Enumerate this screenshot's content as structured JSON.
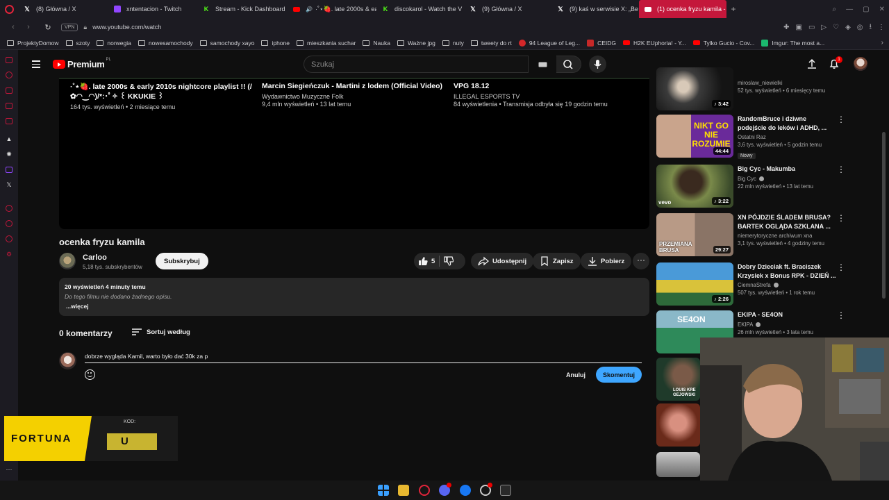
{
  "browser": {
    "tabs": [
      {
        "label": "(8) Główna / X",
        "icon": "x-logo-icon"
      },
      {
        "label": "xntentacion - Twitch",
        "icon": "twitch-icon"
      },
      {
        "label": "Stream - Kick Dashboard",
        "icon": "kick-icon"
      },
      {
        "label": "·˚⋆🍓. late 2000s & ear",
        "icon": "youtube-icon"
      },
      {
        "label": "discokarol - Watch the V",
        "icon": "kick-icon"
      },
      {
        "label": "(9) Główna / X",
        "icon": "x-logo-icon"
      },
      {
        "label": "(9) kaś w serwisie X: „Be",
        "icon": "x-logo-icon"
      },
      {
        "label": "(1) ocenka fryzu kamila -",
        "icon": "youtube-icon"
      }
    ],
    "vpn_label": "VPN",
    "url": "www.youtube.com/watch",
    "bookmarks": [
      {
        "label": "ProjektyDomow",
        "type": "folder"
      },
      {
        "label": "szoty",
        "type": "folder"
      },
      {
        "label": "norwegia",
        "type": "folder"
      },
      {
        "label": "nowesamochody",
        "type": "folder"
      },
      {
        "label": "samochody xayo",
        "type": "folder"
      },
      {
        "label": "iphone",
        "type": "folder"
      },
      {
        "label": "mieszkania suchar",
        "type": "folder"
      },
      {
        "label": "Nauka",
        "type": "folder"
      },
      {
        "label": "Ważne jpg",
        "type": "folder"
      },
      {
        "label": "nuty",
        "type": "folder"
      },
      {
        "label": "tweety do rt",
        "type": "folder"
      },
      {
        "label": "94 League of Leg...",
        "type": "site",
        "color": "#d4272a"
      },
      {
        "label": "CEIDG",
        "type": "site",
        "color": "#c62828"
      },
      {
        "label": "H2K EUphoria! - Y...",
        "type": "site",
        "color": "#ff0000"
      },
      {
        "label": "Tylko Gucio - Cov...",
        "type": "site",
        "color": "#ff0000"
      },
      {
        "label": "Imgur: The most a...",
        "type": "site",
        "color": "#1bb76e"
      }
    ]
  },
  "youtube": {
    "logo_word": "Premium",
    "logo_region": "PL",
    "search_placeholder": "Szukaj",
    "notif_count": "1"
  },
  "endcards": [
    {
      "title": "·˚⋆🍓. late 2000s & early 2010s nightcore playlist !! (/✿◠‿◠)/*:･ﾟ✧ ꒰ KKUKIE ꒱",
      "meta": "164 tys. wyświetleń • 2 miesiące temu"
    },
    {
      "title": "Marcin Siegieńczuk - Martini z lodem (Official Video)",
      "channel": "Wydawnictwo Muzyczne Folk",
      "meta": "9,4 mln wyświetleń • 13 lat temu"
    },
    {
      "title": "VPG 18.12",
      "channel": "ILLEGAL ESPORTS TV",
      "meta": "84 wyświetlenia • Transmisja odbyła się 19 godzin temu"
    }
  ],
  "video": {
    "title": "ocenka fryzu kamila",
    "channel": "Carloo",
    "subscribers": "5,18 tys. subskrybentów",
    "subscribe_label": "Subskrybuj",
    "likes": "5",
    "share_label": "Udostępnij",
    "save_label": "Zapisz",
    "download_label": "Pobierz",
    "description": {
      "stats": "20 wyświetleń  4 minuty temu",
      "text": "Do tego filmu nie dodano żadnego opisu.",
      "more": "...więcej"
    }
  },
  "comments": {
    "count": "0 komentarzy",
    "sort_label": "Sortuj według",
    "draft": "dobrze wygląda Kamil, warto było dać 30k za p",
    "cancel_label": "Anuluj",
    "submit_label": "Skomentuj"
  },
  "recommendations": [
    {
      "title": "",
      "channel": "miroslaw_niewielki",
      "meta": "52 tys. wyświetleń • 6 miesięcy temu",
      "duration": "♪ 3:42",
      "verified": false,
      "badge": ""
    },
    {
      "title": "RandomBruce i dziwne podejście do leków i ADHD, ...",
      "channel": "Ostatni Raz",
      "meta": "3,6 tys. wyświetleń • 5 godzin temu",
      "duration": "44:44",
      "verified": false,
      "badge": "Nowy"
    },
    {
      "title": "Big Cyc - Makumba",
      "channel": "Big Cyc",
      "meta": "22 mln wyświetleń • 13 lat temu",
      "duration": "♪ 3:22",
      "verified": true,
      "badge": ""
    },
    {
      "title": "XN PÓJDZIE ŚLADEM BRUSA? BARTEK OGLĄDA SZKLANA ...",
      "channel": "niemerytoryczne archiwum xna",
      "meta": "3,1 tys. wyświetleń • 4 godziny temu",
      "duration": "29:27",
      "verified": false,
      "badge": ""
    },
    {
      "title": "Dobry Dzieciak ft. Braciszek Krzysiek x Bonus RPK - DZIEŃ ...",
      "channel": "CiemnaStrefa",
      "meta": "507 tys. wyświetleń • 1 rok temu",
      "duration": "♪ 2:26",
      "verified": true,
      "badge": ""
    },
    {
      "title": "EKIPA - SE4ON",
      "channel": "EKIPA",
      "meta": "26 mln wyświetleń • 3 lata temu",
      "duration": "",
      "verified": true,
      "badge": ""
    }
  ],
  "thumb_texts": {
    "rec2": "NIKT GO NIE ROZUMIE",
    "rec3": "vevo",
    "rec4": "PRZEMIANA BRUSA",
    "rec6": "SE4ON",
    "rec7": "LOUIS KRE GEJOWSKI"
  },
  "ad": {
    "brand": "FORTUNA",
    "code_label": "KOD:",
    "code": "U"
  }
}
